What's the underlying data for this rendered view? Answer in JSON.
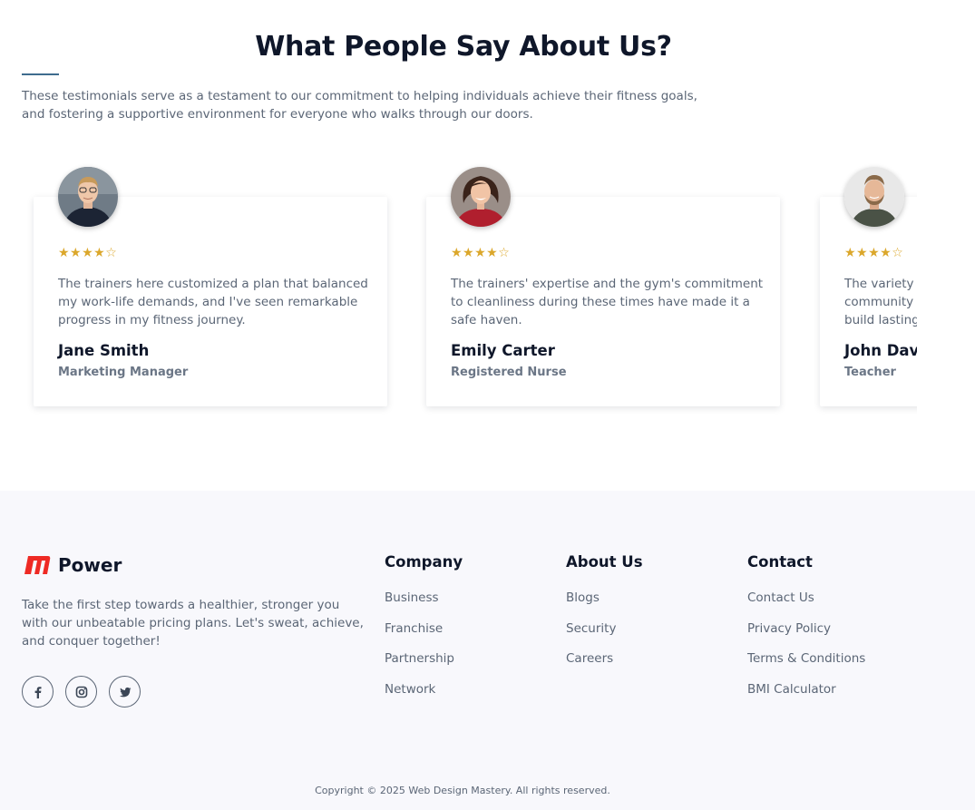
{
  "testimonials": {
    "title": "What People Say About Us?",
    "description": "These testimonials serve as a testament to our commitment to helping individuals achieve their fitness goals, and fostering a supportive environment for everyone who walks through our doors.",
    "rating_glyphs": "★★★★☆",
    "rating_value": 4,
    "rating_max": 5,
    "star_color": "#dba72b",
    "cards": [
      {
        "quote": "The trainers here customized a plan that balanced my work-life demands, and I've seen remarkable progress in my fitness journey.",
        "name": "Jane Smith",
        "role": "Marketing Manager"
      },
      {
        "quote": "The trainers' expertise and the gym's commitment to cleanliness during these times have made it a safe haven.",
        "name": "Emily Carter",
        "role": "Registered Nurse"
      },
      {
        "quote": "The variety of classes and the supportive community have helped me shed pounds and build lasting habits.",
        "name": "John Davis",
        "role": "Teacher"
      }
    ]
  },
  "footer": {
    "brand_name": "Power",
    "brand_color": "#ee2a24",
    "description": "Take the first step towards a healthier, stronger you with our unbeatable pricing plans. Let's sweat, achieve, and conquer together!",
    "socials": [
      {
        "icon": "facebook-icon"
      },
      {
        "icon": "instagram-icon"
      },
      {
        "icon": "twitter-icon"
      }
    ],
    "columns": {
      "company": {
        "title": "Company",
        "links": [
          "Business",
          "Franchise",
          "Partnership",
          "Network"
        ]
      },
      "about": {
        "title": "About Us",
        "links": [
          "Blogs",
          "Security",
          "Careers"
        ]
      },
      "contact": {
        "title": "Contact",
        "links": [
          "Contact Us",
          "Privacy Policy",
          "Terms & Conditions",
          "BMI Calculator"
        ]
      }
    },
    "copyright": "Copyright © 2025 Web Design Mastery. All rights reserved."
  },
  "colors": {
    "heading": "#0f172a",
    "body_text": "#5b6676",
    "accent_bar": "#3e6c8e",
    "footer_bg": "#f8f8fc"
  }
}
